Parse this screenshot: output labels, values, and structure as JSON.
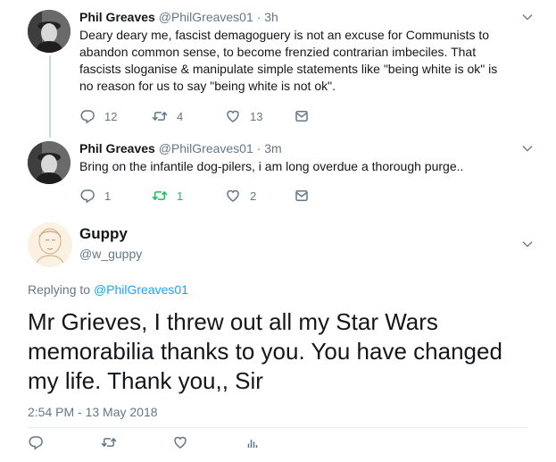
{
  "thread": [
    {
      "name": "Phil Greaves",
      "handle": "@PhilGreaves01",
      "time": "3h",
      "text": "Deary deary me, fascist demagoguery is not an excuse for Communists to abandon common sense, to become frenzied contrarian imbeciles. That fascists sloganise & manipulate simple statements like \"being white is ok\" is no reason for us to say \"being white is not ok\".",
      "replies": "12",
      "retweets": "4",
      "likes": "13"
    },
    {
      "name": "Phil Greaves",
      "handle": "@PhilGreaves01",
      "time": "3m",
      "text": "Bring on the infantile dog-pilers, i am long overdue a thorough purge..",
      "replies": "1",
      "retweets": "1",
      "likes": "2"
    }
  ],
  "main_tweet": {
    "name": "Guppy",
    "handle": "@w_guppy",
    "replying_prefix": "Replying to",
    "replying_to": "@PhilGreaves01",
    "text": "Mr Grieves, I threw out all my Star Wars memorabilia thanks to you. You have changed my life. Thank you,, Sir",
    "timestamp": "2:54 PM - 13 May 2018"
  },
  "separator": "·",
  "icons": {
    "reply": "reply-icon",
    "retweet": "retweet-icon",
    "like": "heart-icon",
    "message": "envelope-icon",
    "analytics": "analytics-icon",
    "menu": "chevron-down-icon"
  },
  "colors": {
    "name": "#14171a",
    "muted": "#657786",
    "link": "#1da1f2",
    "retweet_active": "#17bf63",
    "thread_line": "#c4d9e8"
  }
}
